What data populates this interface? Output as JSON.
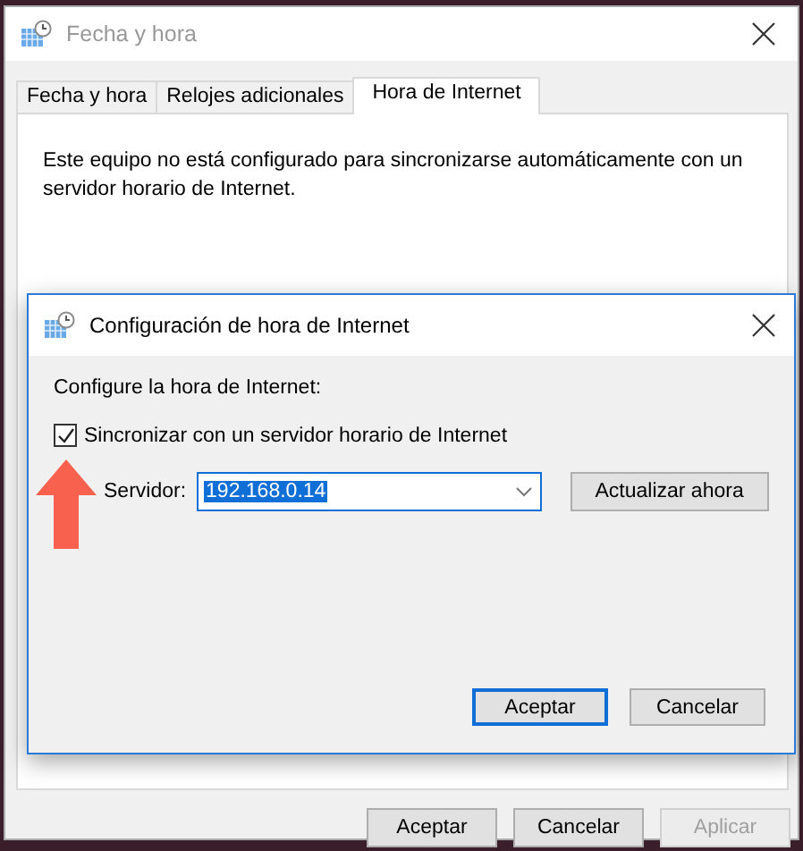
{
  "window": {
    "title": "Fecha y hora"
  },
  "tabs": [
    {
      "label": "Fecha y hora",
      "selected": false
    },
    {
      "label": "Relojes adicionales",
      "selected": false
    },
    {
      "label": "Hora de Internet",
      "selected": true
    }
  ],
  "panel": {
    "message": "Este equipo no está configurado para sincronizarse automáticamente con un servidor horario de Internet."
  },
  "buttons": [
    {
      "label": "Aceptar",
      "disabled": false
    },
    {
      "label": "Cancelar",
      "disabled": false
    },
    {
      "label": "Aplicar",
      "disabled": true
    }
  ],
  "dialog": {
    "title": "Configuración de hora de Internet",
    "heading": "Configure la hora de Internet:",
    "sync": {
      "label": "Sincronizar con un servidor horario de Internet",
      "checked": true
    },
    "server_label": "Servidor:",
    "server": {
      "value": "192.168.0.14"
    },
    "update_button": "Actualizar ahora",
    "buttons": [
      {
        "label": "Aceptar",
        "default": true
      },
      {
        "label": "Cancelar",
        "default": false
      }
    ]
  }
}
